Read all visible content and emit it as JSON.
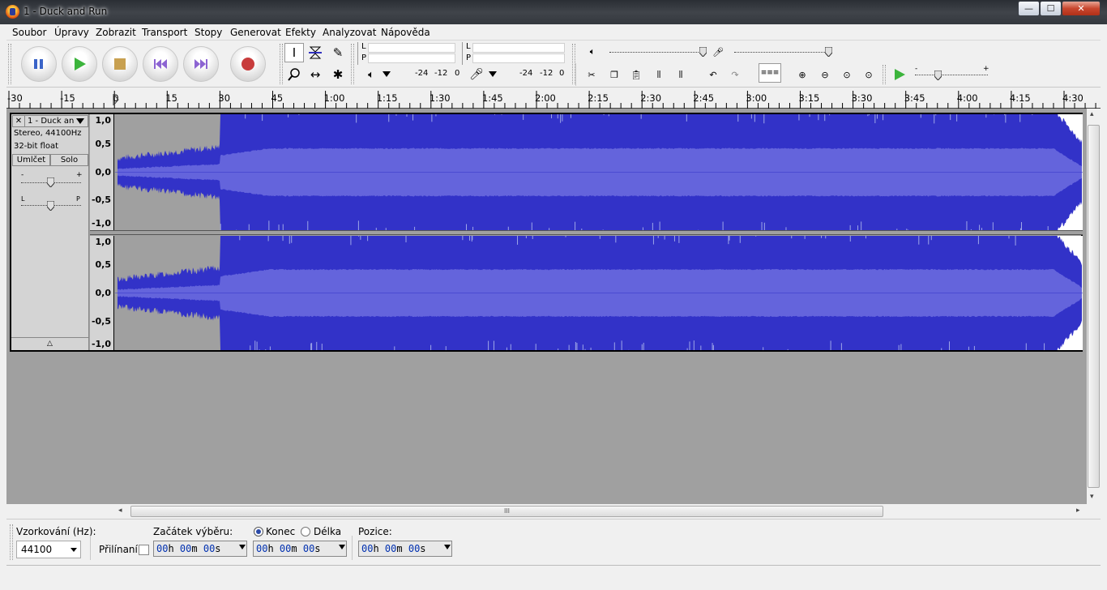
{
  "window": {
    "title": "1 - Duck and Run",
    "min": "—",
    "max": "☐",
    "close": "✕"
  },
  "menu": [
    "Soubor",
    "Úpravy",
    "Zobrazit",
    "Transport",
    "Stopy",
    "Generovat",
    "Efekty",
    "Analyzovat",
    "Nápověda"
  ],
  "meters": {
    "play": {
      "left": "L",
      "right": "P",
      "scale": [
        "-24",
        "-12",
        "0"
      ]
    },
    "record": {
      "left": "L",
      "right": "P",
      "scale": [
        "-24",
        "-12",
        "0"
      ]
    }
  },
  "ruler": {
    "labels": [
      "-30",
      "-15",
      "0",
      "15",
      "30",
      "45",
      "1:00",
      "1:15",
      "1:30",
      "1:45",
      "2:00",
      "2:15",
      "2:30",
      "2:45",
      "3:00",
      "3:15",
      "3:30",
      "3:45",
      "4:00",
      "4:15",
      "4:30"
    ]
  },
  "track": {
    "name": "1 - Duck an",
    "info1": "Stereo, 44100Hz",
    "info2": "32-bit float",
    "mute": "Umlčet",
    "solo": "Solo",
    "gain_minus": "-",
    "gain_plus": "+",
    "pan_left": "L",
    "pan_right": "P",
    "collapse": "△",
    "close": "✕",
    "vruler": [
      "1,0",
      "0,5",
      "0,0",
      "-0,5",
      "-1,0"
    ]
  },
  "colors": {
    "waveform": "#3232c8",
    "rms": "#6464dc",
    "bg": "#a0a0a0"
  },
  "selection": {
    "rate_label": "Vzorkování (Hz):",
    "rate_value": "44100",
    "snap_label": "Přilínaní",
    "start_label": "Začátek výběru:",
    "end_label": "Konec",
    "length_label": "Délka",
    "position_label": "Pozice:",
    "time": {
      "h": "00",
      "m": "00",
      "s": "00",
      "hu": "h",
      "mu": "m",
      "su": "s"
    }
  },
  "scroll": {
    "grip": "III",
    "left": "◂",
    "right": "▸",
    "up": "▴",
    "down": "▾"
  }
}
